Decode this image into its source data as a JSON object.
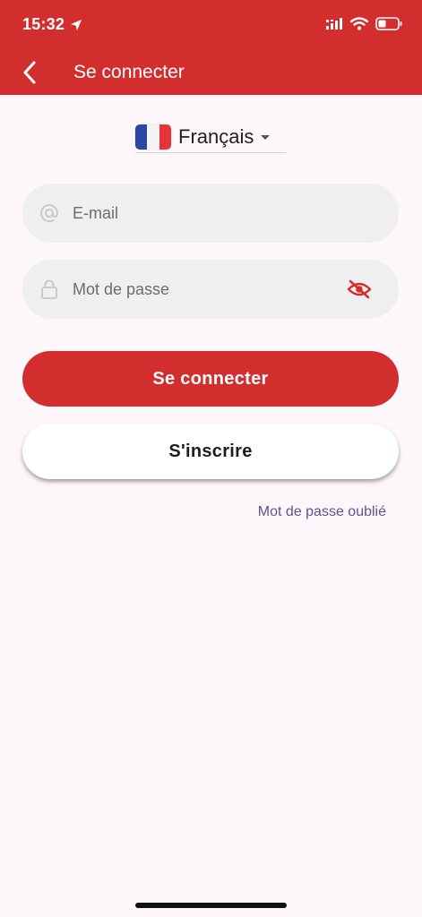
{
  "status_bar": {
    "time": "15:32",
    "location_icon": "location-arrow-icon",
    "signal_icon": "signal-icon",
    "wifi_icon": "wifi-icon",
    "battery_icon": "battery-icon"
  },
  "header": {
    "title": "Se connecter",
    "back_icon": "chevron-left-icon",
    "background_color": "#d32e2e"
  },
  "language": {
    "selected": "Français",
    "flag_icon": "france-flag-icon"
  },
  "form": {
    "email": {
      "placeholder": "E-mail",
      "value": "",
      "icon": "at-sign-icon"
    },
    "password": {
      "placeholder": "Mot de passe",
      "value": "",
      "icon": "lock-icon",
      "toggle_icon": "eye-off-icon"
    }
  },
  "actions": {
    "login_label": "Se connecter",
    "signup_label": "S'inscrire",
    "forgot_label": "Mot de passe oublié"
  },
  "colors": {
    "primary": "#d32e2e",
    "background": "#fdf6fb",
    "field": "#efeef0",
    "link": "#5e5490"
  }
}
